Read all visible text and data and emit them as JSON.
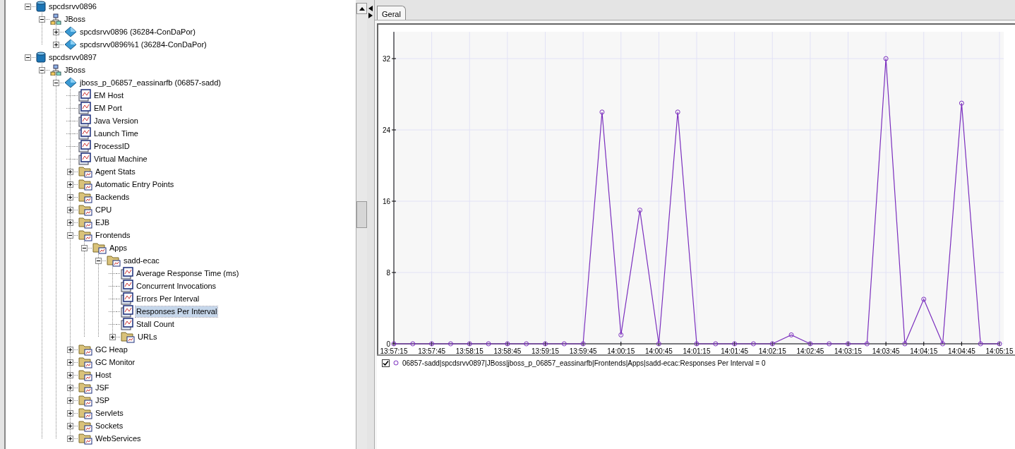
{
  "tree": [
    {
      "label": "spcdsrvv0896",
      "kind": "server",
      "expanded": true,
      "selected": false,
      "children": [
        {
          "label": "JBoss",
          "kind": "group",
          "expanded": true,
          "selected": false,
          "children": [
            {
              "label": "spcdsrvv0896 (36284-ConDaPor)",
              "kind": "agent",
              "expanded": false,
              "selected": false
            },
            {
              "label": "spcdsrvv0896%1 (36284-ConDaPor)",
              "kind": "agent",
              "expanded": false,
              "selected": false
            }
          ]
        }
      ]
    },
    {
      "label": "spcdsrvv0897",
      "kind": "server",
      "expanded": true,
      "selected": false,
      "children": [
        {
          "label": "JBoss",
          "kind": "group",
          "expanded": true,
          "selected": false,
          "children": [
            {
              "label": "jboss_p_06857_eassinarfb (06857-sadd)",
              "kind": "agent",
              "expanded": true,
              "selected": false,
              "children": [
                {
                  "label": "EM Host",
                  "kind": "metric",
                  "selected": false
                },
                {
                  "label": "EM Port",
                  "kind": "metric",
                  "selected": false
                },
                {
                  "label": "Java Version",
                  "kind": "metric",
                  "selected": false
                },
                {
                  "label": "Launch Time",
                  "kind": "metric",
                  "selected": false
                },
                {
                  "label": "ProcessID",
                  "kind": "metric",
                  "selected": false
                },
                {
                  "label": "Virtual Machine",
                  "kind": "metric",
                  "selected": false
                },
                {
                  "label": "Agent Stats",
                  "kind": "folder",
                  "expanded": false,
                  "selected": false
                },
                {
                  "label": "Automatic Entry Points",
                  "kind": "folder",
                  "expanded": false,
                  "selected": false
                },
                {
                  "label": "Backends",
                  "kind": "folder",
                  "expanded": false,
                  "selected": false
                },
                {
                  "label": "CPU",
                  "kind": "folder",
                  "expanded": false,
                  "selected": false
                },
                {
                  "label": "EJB",
                  "kind": "folder",
                  "expanded": false,
                  "selected": false
                },
                {
                  "label": "Frontends",
                  "kind": "folder",
                  "expanded": true,
                  "selected": false,
                  "children": [
                    {
                      "label": "Apps",
                      "kind": "folder",
                      "expanded": true,
                      "selected": false,
                      "children": [
                        {
                          "label": "sadd-ecac",
                          "kind": "folder",
                          "expanded": true,
                          "selected": false,
                          "children": [
                            {
                              "label": "Average Response Time (ms)",
                              "kind": "metric",
                              "selected": false
                            },
                            {
                              "label": "Concurrent Invocations",
                              "kind": "metric",
                              "selected": false
                            },
                            {
                              "label": "Errors Per Interval",
                              "kind": "metric",
                              "selected": false
                            },
                            {
                              "label": "Responses Per Interval",
                              "kind": "metric",
                              "selected": true
                            },
                            {
                              "label": "Stall Count",
                              "kind": "metric",
                              "selected": false
                            },
                            {
                              "label": "URLs",
                              "kind": "folder",
                              "expanded": false,
                              "selected": false
                            }
                          ]
                        }
                      ]
                    }
                  ]
                },
                {
                  "label": "GC Heap",
                  "kind": "folder",
                  "expanded": false,
                  "selected": false
                },
                {
                  "label": "GC Monitor",
                  "kind": "folder",
                  "expanded": false,
                  "selected": false
                },
                {
                  "label": "Host",
                  "kind": "folder",
                  "expanded": false,
                  "selected": false
                },
                {
                  "label": "JSF",
                  "kind": "folder",
                  "expanded": false,
                  "selected": false
                },
                {
                  "label": "JSP",
                  "kind": "folder",
                  "expanded": false,
                  "selected": false
                },
                {
                  "label": "Servlets",
                  "kind": "folder",
                  "expanded": false,
                  "selected": false
                },
                {
                  "label": "Sockets",
                  "kind": "folder",
                  "expanded": false,
                  "selected": false
                },
                {
                  "label": "WebServices",
                  "kind": "folder",
                  "expanded": false,
                  "selected": false
                }
              ]
            }
          ]
        }
      ]
    }
  ],
  "tabs": [
    {
      "label": "Geral",
      "selected": true
    }
  ],
  "chart_data": {
    "type": "line",
    "categories": [
      "13:57:15",
      null,
      "13:57:45",
      null,
      "13:58:15",
      null,
      "13:58:45",
      null,
      "13:59:15",
      null,
      "13:59:45",
      null,
      "14:00:15",
      null,
      "14:00:45",
      null,
      "14:01:15",
      null,
      "14:01:45",
      null,
      "14:02:15",
      null,
      "14:02:45",
      null,
      "14:03:15",
      null,
      "14:03:45",
      null,
      "14:04:15",
      null,
      "14:04:45",
      null,
      "14:05:15"
    ],
    "grid": true,
    "series": [
      {
        "color": "#7b2fbe",
        "marker": "circle",
        "values": [
          0,
          0,
          0,
          0,
          0,
          0,
          0,
          0,
          0,
          0,
          0,
          26,
          1,
          15,
          0,
          26,
          0,
          0,
          0,
          0,
          0,
          1,
          0,
          0,
          0,
          0,
          32,
          0,
          5,
          0,
          27,
          0,
          0
        ]
      }
    ],
    "ylim": [
      0,
      35
    ],
    "yticks": [
      0,
      8,
      16,
      24,
      32
    ]
  },
  "legend": [
    {
      "label": "06857-sadd|spcdsrvv0897|JBoss|jboss_p_06857_eassinarfb|Frontends|Apps|sadd-ecac:Responses Per Interval = 0",
      "checked": true
    }
  ]
}
